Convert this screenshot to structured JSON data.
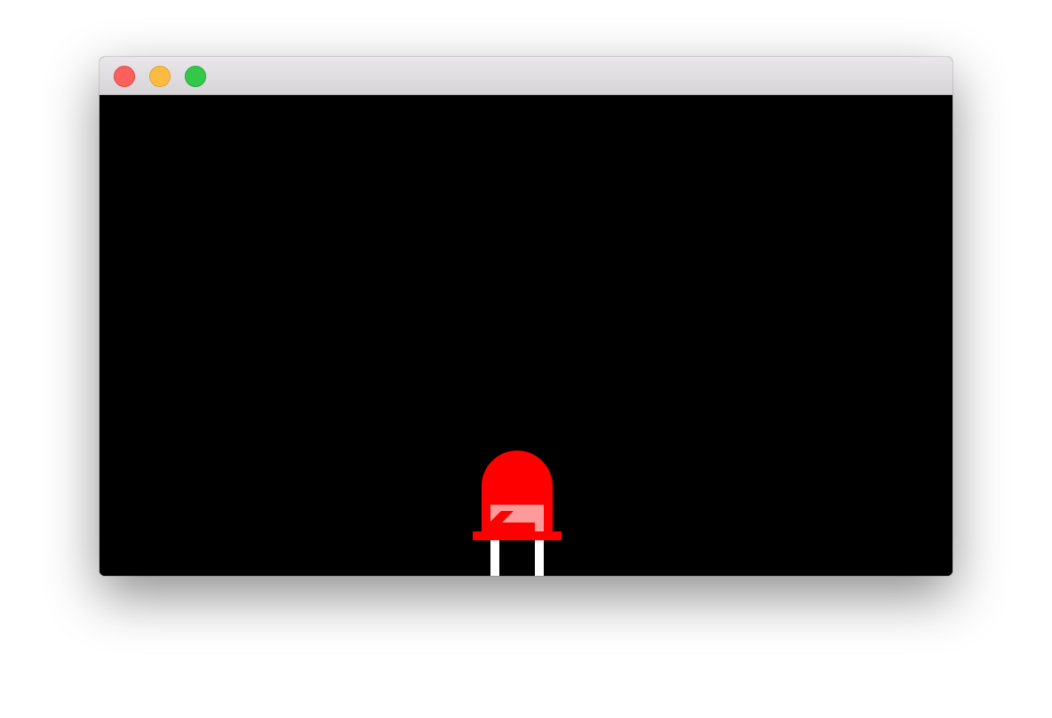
{
  "window": {
    "title": "",
    "controls": {
      "close": "close-button",
      "minimize": "minimize-button",
      "zoom": "zoom-button"
    }
  },
  "scene": {
    "background": "#000000",
    "led": {
      "state": "on",
      "body_color": "#ff0000",
      "highlight_color": "#ff9a9a",
      "lead_color": "#ffffff"
    }
  },
  "colors": {
    "close": "#fc605c",
    "minimize": "#fdbc40",
    "zoom": "#34c84a"
  }
}
